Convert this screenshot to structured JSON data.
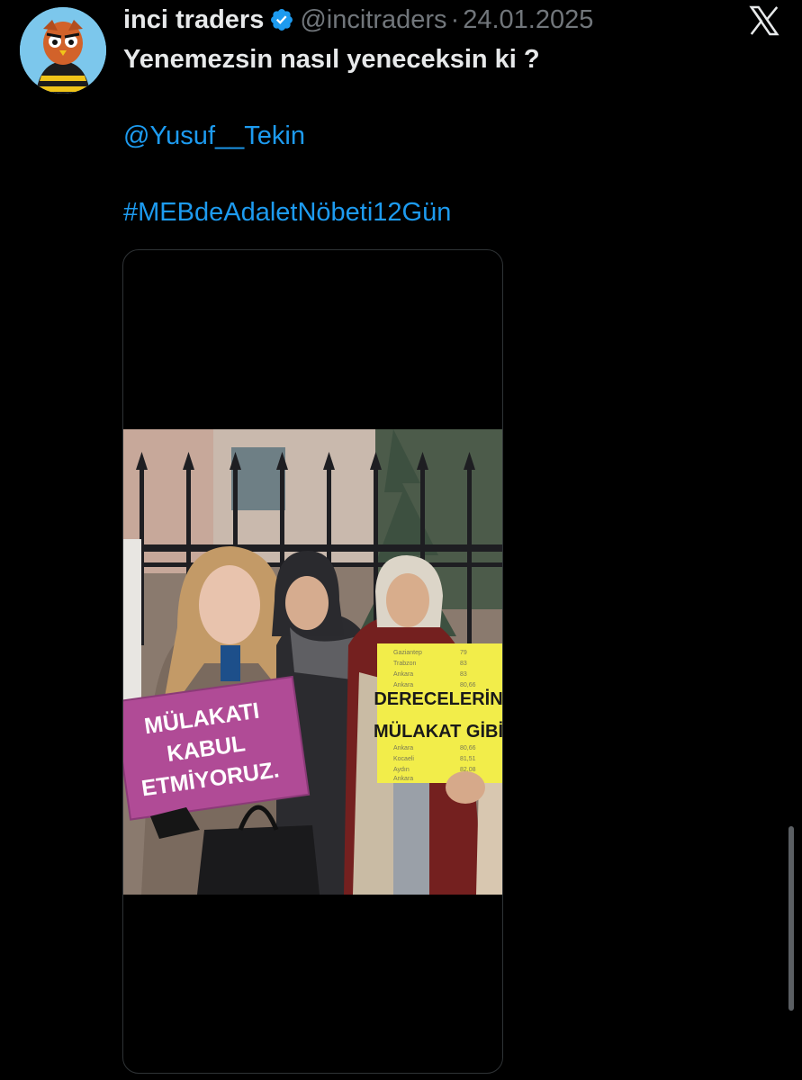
{
  "tweet": {
    "author_name": "inci traders",
    "handle": "@incitraders",
    "separator": "·",
    "date": "24.01.2025",
    "text_line": "Yenemezsin nasıl yeneceksin ki ?",
    "mention": "@Yusuf__Tekin",
    "hashtag": "#MEBdeAdaletNöbeti12Gün"
  },
  "image": {
    "sign_left": [
      "MÜLAKATI",
      "KABUL",
      "ETMİYORUZ."
    ],
    "sign_right": [
      "DERECELERİN",
      "MÜLAKAT GİBİ"
    ],
    "sign_right_table": [
      {
        "city": "Gaziantep",
        "score": "79"
      },
      {
        "city": "Trabzon",
        "score": "83"
      },
      {
        "city": "Ankara",
        "score": "83"
      },
      {
        "city": "Ankara",
        "score": "80,66"
      },
      {
        "city": "Ankara",
        "score": "80,66"
      },
      {
        "city": "Kocaeli",
        "score": "81,51"
      },
      {
        "city": "Aydın",
        "score": "82,08"
      },
      {
        "city": "Ankara",
        "score": ""
      }
    ]
  },
  "icons": {
    "verified": "verified-badge-icon",
    "close": "x-logo-icon"
  },
  "colors": {
    "background": "#000000",
    "link": "#1d9bf0",
    "muted": "#71767b",
    "verified": "#1d9bf0"
  }
}
